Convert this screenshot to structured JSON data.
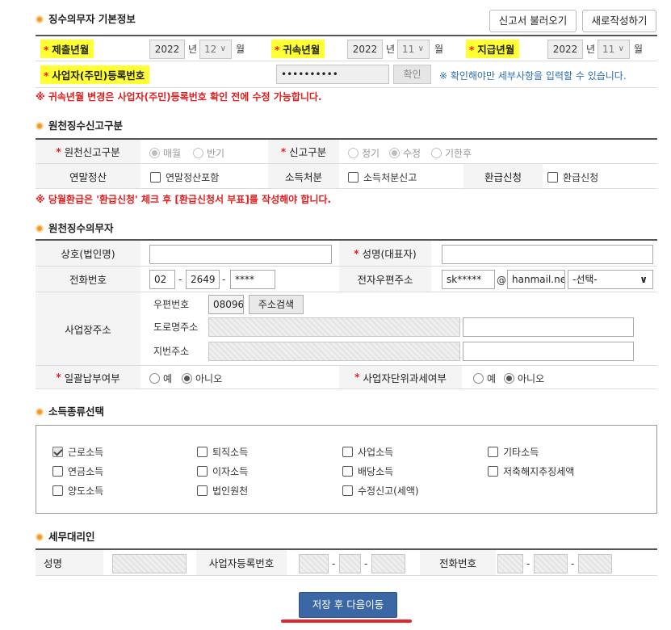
{
  "basic": {
    "title": "징수의무자 기본정보",
    "load_button": "신고서 불러오기",
    "new_button": "새로작성하기",
    "submit_ym_label": "제출년월",
    "submit_year": "2022",
    "submit_month": "12",
    "attr_ym_label": "귀속년월",
    "attr_year": "2022",
    "attr_month": "11",
    "pay_ym_label": "지급년월",
    "pay_year": "2022",
    "pay_month": "11",
    "year_unit": "년",
    "month_unit": "월",
    "biz_no_label": "사업자(주민)등록번호",
    "biz_no_value": "••••••••••",
    "confirm_button": "확인",
    "confirm_note": "※ 확인해야만 세부사항을 입력할 수 있습니다.",
    "warning": "※ 귀속년월 변경은 사업자(주민)등록번호 확인 전에 수정 가능합니다."
  },
  "report_type": {
    "title": "원천징수신고구분",
    "withholding_label": "원천신고구분",
    "withholding_options": [
      "매월",
      "반기"
    ],
    "report_label": "신고구분",
    "report_options": [
      "정기",
      "수정",
      "기한후"
    ],
    "yearend_label": "연말정산",
    "yearend_check": "연말정산포함",
    "income_disp_label": "소득처분",
    "income_disp_check": "소득처분신고",
    "refund_label": "환급신청",
    "refund_check": "환급신청",
    "warning": "※ 당월환급은 '환급신청' 체크 후 [환급신청서 부표]를 작성해야 합니다."
  },
  "agent": {
    "title": "원천징수의무자",
    "company_label": "상호(법인명)",
    "rep_label": "성명(대표자)",
    "phone_label": "전화번호",
    "phone1": "02",
    "phone2": "2649",
    "phone3": "****",
    "email_label": "전자우편주소",
    "email_id": "sk*****",
    "email_at": "@",
    "email_domain": "hanmail.net",
    "email_select": "-선택-",
    "address_label": "사업장주소",
    "zip_label": "우편번호",
    "zip_value": "08096",
    "zip_search_button": "주소검색",
    "road_label": "도로명주소",
    "lot_label": "지번주소",
    "bulk_pay_label": "일괄납부여부",
    "unit_tax_label": "사업자단위과세여부",
    "yes": "예",
    "no": "아니오",
    "dash": "-"
  },
  "income_types": {
    "title": "소득종류선택",
    "items": [
      "근로소득",
      "퇴직소득",
      "사업소득",
      "기타소득",
      "연금소득",
      "이자소득",
      "배당소득",
      "저축해지추징세액",
      "양도소득",
      "법인원천",
      "수정신고(세액)"
    ]
  },
  "tax_agent": {
    "title": "세무대리인",
    "name_label": "성명",
    "biz_no_label": "사업자등록번호",
    "phone_label": "전화번호"
  },
  "save_button": "저장 후 다음이동"
}
